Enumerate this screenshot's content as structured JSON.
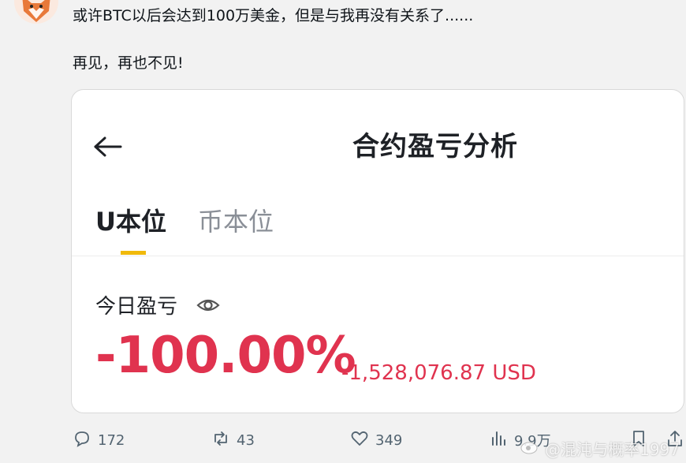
{
  "tweet": {
    "line1": "或许BTC以后会达到100万美金，但是与我再没有关系了......",
    "line2": "再见，再也不见!"
  },
  "card": {
    "title": "合约盈亏分析",
    "tabs": [
      {
        "label": "U本位",
        "active": true
      },
      {
        "label": "币本位",
        "active": false
      }
    ],
    "pnl_label": "今日盈亏",
    "pnl_percent": "-100.00%",
    "pnl_usd": "-1,528,076.87 USD"
  },
  "actions": {
    "reply_count": "172",
    "retweet_count": "43",
    "like_count": "349",
    "views_count": "9.9万"
  },
  "watermark": {
    "text": "@混沌与概率1997"
  },
  "colors": {
    "loss_red": "#e0334f",
    "accent_yellow": "#f0b90b"
  },
  "icons": [
    "fox-avatar",
    "back-arrow-icon",
    "eye-icon",
    "reply-icon",
    "retweet-icon",
    "like-icon",
    "views-icon",
    "bookmark-icon",
    "share-icon",
    "weibo-icon"
  ]
}
